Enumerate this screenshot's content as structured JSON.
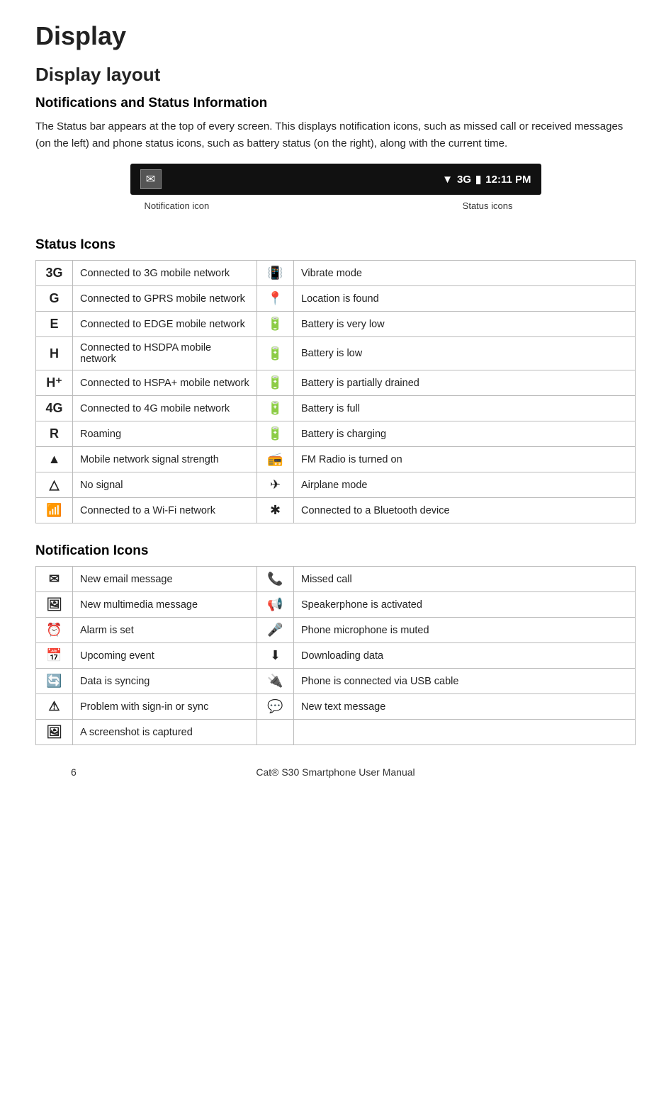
{
  "page": {
    "title": "Display",
    "section1_title": "Display layout",
    "subsection1_title": "Notifications and Status Information",
    "body_text": "The Status bar appears at the top of every screen. This displays notification icons, such as missed call or received messages (on the left) and phone status icons, such as battery status (on the right), along with the current time.",
    "statusbar": {
      "left_icon": "✉",
      "right_content": "▼ 3G  ▮  12:11 PM",
      "label_notification": "Notification icon",
      "label_status": "Status icons"
    },
    "subsection2_title": "Status Icons",
    "status_icons": [
      {
        "icon": "3G",
        "desc": "Connected to 3G mobile network",
        "icon2": "📳",
        "desc2": "Vibrate mode"
      },
      {
        "icon": "G",
        "desc": "Connected to GPRS mobile network",
        "icon2": "📍",
        "desc2": "Location is found"
      },
      {
        "icon": "E",
        "desc": "Connected to EDGE mobile network",
        "icon2": "🔋",
        "desc2": "Battery is very low"
      },
      {
        "icon": "H",
        "desc": "Connected to HSDPA mobile network",
        "icon2": "🔋",
        "desc2": "Battery is low"
      },
      {
        "icon": "H⁺",
        "desc": "Connected to HSPA+ mobile network",
        "icon2": "🔋",
        "desc2": "Battery is partially drained"
      },
      {
        "icon": "4G",
        "desc": "Connected to 4G mobile network",
        "icon2": "🔋",
        "desc2": "Battery is full"
      },
      {
        "icon": "R",
        "desc": "Roaming",
        "icon2": "🔋",
        "desc2": "Battery is charging"
      },
      {
        "icon": "▲",
        "desc": "Mobile network signal strength",
        "icon2": "📻",
        "desc2": "FM Radio is turned on"
      },
      {
        "icon": "△",
        "desc": "No signal",
        "icon2": "✈",
        "desc2": "Airplane mode"
      },
      {
        "icon": "📶",
        "desc": "Connected to a Wi-Fi network",
        "icon2": "✱",
        "desc2": "Connected to a Bluetooth device"
      }
    ],
    "subsection3_title": "Notification Icons",
    "notification_icons": [
      {
        "icon": "✉",
        "desc": "New email message",
        "icon2": "📞",
        "desc2": "Missed call"
      },
      {
        "icon": "🖼",
        "desc": "New multimedia message",
        "icon2": "📢",
        "desc2": "Speakerphone is activated"
      },
      {
        "icon": "⏰",
        "desc": "Alarm is set",
        "icon2": "🎤",
        "desc2": "Phone microphone is muted"
      },
      {
        "icon": "📅",
        "desc": "Upcoming event",
        "icon2": "⬇",
        "desc2": "Downloading data"
      },
      {
        "icon": "🔄",
        "desc": "Data is syncing",
        "icon2": "🔌",
        "desc2": "Phone is connected via USB cable"
      },
      {
        "icon": "⚠",
        "desc": "Problem with sign-in or sync",
        "icon2": "💬",
        "desc2": "New text message"
      },
      {
        "icon": "🖼",
        "desc": "A screenshot is captured",
        "icon2": "",
        "desc2": ""
      }
    ],
    "footer_page": "6",
    "footer_text": "Cat® S30 Smartphone User Manual"
  }
}
